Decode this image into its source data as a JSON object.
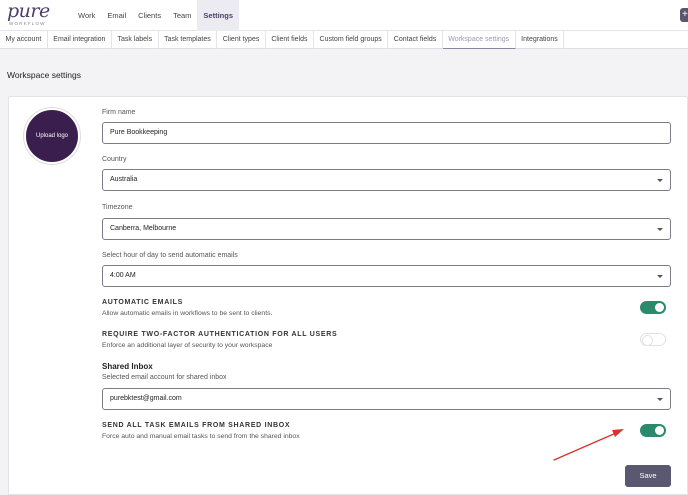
{
  "brand": {
    "logo_word": "pure",
    "logo_sub": "WORKFLOW"
  },
  "main_nav": [
    {
      "label": "Work",
      "active": false
    },
    {
      "label": "Email",
      "active": false
    },
    {
      "label": "Clients",
      "active": false
    },
    {
      "label": "Team",
      "active": false
    },
    {
      "label": "Settings",
      "active": true
    }
  ],
  "sub_nav": [
    {
      "label": "My account",
      "active": false
    },
    {
      "label": "Email integration",
      "active": false
    },
    {
      "label": "Task labels",
      "active": false
    },
    {
      "label": "Task templates",
      "active": false
    },
    {
      "label": "Client types",
      "active": false
    },
    {
      "label": "Client fields",
      "active": false
    },
    {
      "label": "Custom field groups",
      "active": false
    },
    {
      "label": "Contact fields",
      "active": false
    },
    {
      "label": "Workspace settings",
      "active": true
    },
    {
      "label": "Integrations",
      "active": false
    }
  ],
  "page": {
    "title": "Workspace settings"
  },
  "upload_logo": {
    "label": "Upload logo"
  },
  "fields": {
    "firm_name": {
      "label": "Firm name",
      "value": "Pure Bookkeeping"
    },
    "country": {
      "label": "Country",
      "value": "Australia"
    },
    "timezone": {
      "label": "Timezone",
      "value": "Canberra, Melbourne"
    },
    "email_hour": {
      "label": "Select hour of day to send automatic emails",
      "value": "4:00 AM"
    }
  },
  "toggles": {
    "automatic_emails": {
      "title": "AUTOMATIC EMAILS",
      "description": "Allow automatic emails in workflows to be sent to clients.",
      "on": true
    },
    "two_factor": {
      "title": "REQUIRE TWO-FACTOR AUTHENTICATION FOR ALL USERS",
      "description": "Enforce an additional layer of security to your workspace",
      "on": false
    },
    "shared_inbox_tasks": {
      "title": "SEND ALL TASK EMAILS FROM SHARED INBOX",
      "description": "Force auto and manual email tasks to send from the shared inbox",
      "on": true
    }
  },
  "shared_inbox": {
    "heading": "Shared Inbox",
    "label": "Selected email account for shared inbox",
    "value": "purebktest@gmail.com"
  },
  "actions": {
    "save_label": "Save"
  },
  "colors": {
    "accent": "#4d3d6a",
    "toggle_on": "#2b8a6c",
    "logo_circle": "#3a1f4e",
    "save_button": "#5a5870",
    "annotation_arrow": "#d9322b"
  }
}
